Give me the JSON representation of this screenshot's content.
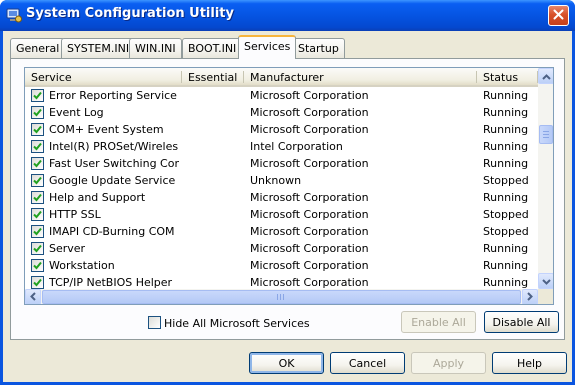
{
  "window": {
    "title": "System Configuration Utility"
  },
  "tabs": [
    {
      "label": "General",
      "active": false
    },
    {
      "label": "SYSTEM.INI",
      "active": false
    },
    {
      "label": "WIN.INI",
      "active": false
    },
    {
      "label": "BOOT.INI",
      "active": false
    },
    {
      "label": "Services",
      "active": true
    },
    {
      "label": "Startup",
      "active": false
    }
  ],
  "services": {
    "columns": [
      "Service",
      "Essential",
      "Manufacturer",
      "Status"
    ],
    "rows": [
      {
        "service": "Error Reporting Service",
        "essential": "",
        "manufacturer": "Microsoft Corporation",
        "status": "Running",
        "checked": true
      },
      {
        "service": "Event Log",
        "essential": "",
        "manufacturer": "Microsoft Corporation",
        "status": "Running",
        "checked": true
      },
      {
        "service": "COM+ Event System",
        "essential": "",
        "manufacturer": "Microsoft Corporation",
        "status": "Running",
        "checked": true
      },
      {
        "service": "Intel(R) PROSet/Wireles...",
        "essential": "",
        "manufacturer": "Intel Corporation",
        "status": "Running",
        "checked": true
      },
      {
        "service": "Fast User Switching Com...",
        "essential": "",
        "manufacturer": "Microsoft Corporation",
        "status": "Running",
        "checked": true
      },
      {
        "service": "Google Update Service (...",
        "essential": "",
        "manufacturer": "Unknown",
        "status": "Stopped",
        "checked": true
      },
      {
        "service": "Help and Support",
        "essential": "",
        "manufacturer": "Microsoft Corporation",
        "status": "Running",
        "checked": true
      },
      {
        "service": "HTTP SSL",
        "essential": "",
        "manufacturer": "Microsoft Corporation",
        "status": "Stopped",
        "checked": true
      },
      {
        "service": "IMAPI CD-Burning COM ...",
        "essential": "",
        "manufacturer": "Microsoft Corporation",
        "status": "Stopped",
        "checked": true
      },
      {
        "service": "Server",
        "essential": "",
        "manufacturer": "Microsoft Corporation",
        "status": "Running",
        "checked": true
      },
      {
        "service": "Workstation",
        "essential": "",
        "manufacturer": "Microsoft Corporation",
        "status": "Running",
        "checked": true
      },
      {
        "service": "TCP/IP NetBIOS Helper",
        "essential": "",
        "manufacturer": "Microsoft Corporation",
        "status": "Running",
        "checked": true
      }
    ]
  },
  "hide_ms": {
    "label": "Hide All Microsoft Services",
    "checked": false
  },
  "buttons": {
    "enable_all": "Enable All",
    "disable_all": "Disable All",
    "ok": "OK",
    "cancel": "Cancel",
    "apply": "Apply",
    "help": "Help"
  },
  "colors": {
    "titlebar": "#0553e0",
    "close": "#d8512a",
    "face": "#ece9d8",
    "active_tab_accent": "#f7b53d",
    "check": "#21a121"
  }
}
